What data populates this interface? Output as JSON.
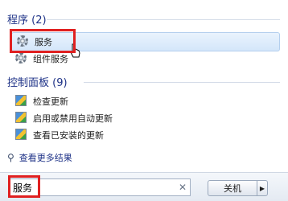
{
  "programs": {
    "header": "程序 (2)",
    "items": [
      {
        "label": "服务",
        "icon": "services-gear-icon"
      },
      {
        "label": "组件服务",
        "icon": "component-services-icon"
      }
    ]
  },
  "control_panel": {
    "header": "控制面板 (9)",
    "items": [
      {
        "label": "检查更新",
        "icon": "control-panel-icon"
      },
      {
        "label": "启用或禁用自动更新",
        "icon": "control-panel-icon"
      },
      {
        "label": "查看已安装的更新",
        "icon": "control-panel-icon"
      }
    ]
  },
  "see_more": {
    "label": "查看更多结果",
    "icon": "search-icon"
  },
  "search": {
    "value": "服务",
    "clear_icon": "clear-icon"
  },
  "shutdown": {
    "label": "关机",
    "arrow": "▶"
  },
  "colors": {
    "highlight": "#e02020",
    "header_text": "#1e3287",
    "selection": "#d4e6fa"
  }
}
